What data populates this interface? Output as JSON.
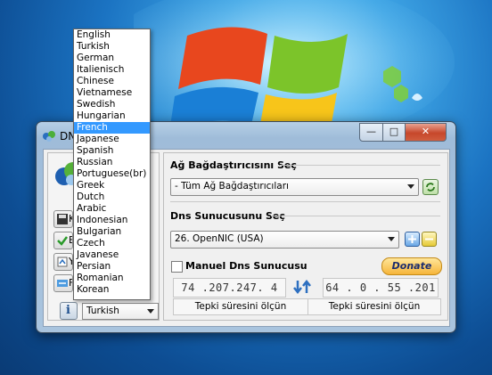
{
  "window": {
    "title": "DN",
    "controls": {
      "minimize": "—",
      "maximize": "□",
      "close": "✕"
    }
  },
  "left_panel": {
    "buttons": [
      {
        "label": "K",
        "icon": "save-icon"
      },
      {
        "label": "E",
        "icon": "checkmark-icon"
      },
      {
        "label": "Y",
        "icon": "backup-icon"
      },
      {
        "label": "F",
        "icon": "refresh-network-icon"
      }
    ],
    "info_label": "i"
  },
  "adapter": {
    "heading": "Ağ Bağdaştırıcısını Seç",
    "selected": "- Tüm Ağ Bağdaştırıcıları"
  },
  "dns_server": {
    "heading": "Dns Sunucusunu Seç",
    "selected": "26. OpenNIC (USA)"
  },
  "manual": {
    "label": "Manuel Dns Sunucusu",
    "checked": false
  },
  "donate_label": "Donate",
  "primary": {
    "ip": "74 .207.247. 4",
    "test_label": "Tepki süresini ölçün"
  },
  "secondary": {
    "ip": "64 . 0 . 55 .201",
    "test_label": "Tepki süresini ölçün"
  },
  "language": {
    "selected": "Turkish",
    "highlighted": "French",
    "options": [
      "English",
      "Turkish",
      "German",
      "Italienisch",
      "Chinese",
      "Vietnamese",
      "Swedish",
      "Hungarian",
      "French",
      "Japanese",
      "Spanish",
      "Russian",
      "Portuguese(br)",
      "Greek",
      "Dutch",
      "Arabic",
      "Indonesian",
      "Bulgarian",
      "Czech",
      "Javanese",
      "Persian",
      "Romanian",
      "Korean"
    ]
  },
  "colors": {
    "highlight": "#3399ff",
    "donate": "#f6b53a",
    "close": "#c7472b"
  }
}
